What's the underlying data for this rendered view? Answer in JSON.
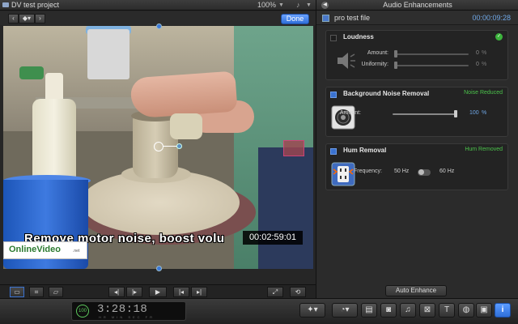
{
  "viewer": {
    "project_title": "DV test project",
    "zoom": "100%",
    "done_label": "Done",
    "caption": "Remove motor noise, boost volu",
    "timecode": "00:02:59:01",
    "logo_text": "OnlineVideo",
    "logo_suffix": ".net"
  },
  "panel": {
    "title": "Audio Enhancements",
    "file_name": "pro test file",
    "file_duration": "00:00:09:28",
    "loudness": {
      "title": "Loudness",
      "enabled": false,
      "amount_label": "Amount:",
      "amount_value": "0",
      "uniformity_label": "Uniformity:",
      "uniformity_value": "0",
      "percent": "%"
    },
    "noise": {
      "title": "Background Noise Removal",
      "enabled": true,
      "status": "Noise Reduced",
      "amount_label": "Amount:",
      "amount_value": "100",
      "percent": "%",
      "amount_level": 1.0
    },
    "hum": {
      "title": "Hum Removal",
      "enabled": true,
      "status": "Hum Removed",
      "frequency_label": "Frequency:",
      "option_50": "50 Hz",
      "option_60": "60 Hz"
    },
    "auto_enhance_label": "Auto Enhance"
  },
  "bottom": {
    "badge": "100",
    "timecode": "3:28:18",
    "timecode_units": "HR MIN SEC FR"
  },
  "colors": {
    "accent": "#3a72d0",
    "status_green": "#4bc24b",
    "value_blue": "#6fa7e6"
  }
}
